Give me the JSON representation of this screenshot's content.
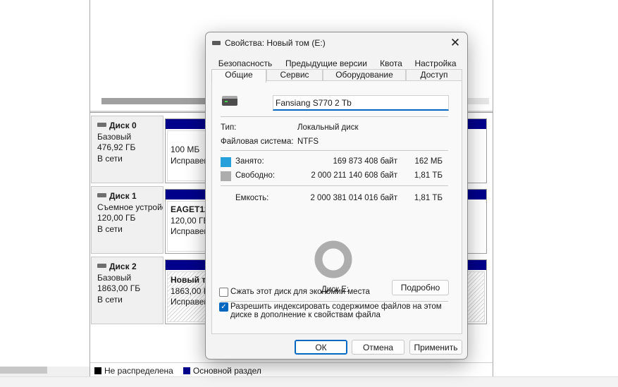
{
  "disk_management": {
    "disks": [
      {
        "name": "Диск 0",
        "type": "Базовый",
        "size": "476,92 ГБ",
        "status": "В сети",
        "partition_line1": "",
        "partition_size": "100 МБ",
        "partition_status": "Исправен"
      },
      {
        "name": "Диск 1",
        "type": "Съемное устройство",
        "size": "120,00 ГБ",
        "status": "В сети",
        "partition_line1": "EAGET128",
        "partition_size": "120,00 ГБ",
        "partition_status": "Исправен"
      },
      {
        "name": "Диск 2",
        "type": "Базовый",
        "size": "1863,00 ГБ",
        "status": "В сети",
        "partition_line1": "Новый том",
        "partition_size": "1863,00 ГБ",
        "partition_status": "Исправен"
      }
    ],
    "legend": {
      "unallocated": "Не распределена",
      "primary": "Основной раздел"
    },
    "colors": {
      "unallocated": "#000000",
      "primary": "#00008b"
    }
  },
  "dialog": {
    "title": "Свойства: Новый том (E:)",
    "tabs_row1": [
      "Безопасность",
      "Предыдущие версии",
      "Квота",
      "Настройка"
    ],
    "tabs_row2": [
      "Общие",
      "Сервис",
      "Оборудование",
      "Доступ"
    ],
    "active_tab": "Общие",
    "volume_label": "Fansiang S770 2 Tb",
    "type_label": "Тип:",
    "type_value": "Локальный диск",
    "fs_label": "Файловая система:",
    "fs_value": "NTFS",
    "used_label": "Занято:",
    "used_bytes": "169 873 408 байт",
    "used_short": "162 МБ",
    "free_label": "Свободно:",
    "free_bytes": "2 000 211 140 608 байт",
    "free_short": "1,81 ТБ",
    "capacity_label": "Емкость:",
    "capacity_bytes": "2 000 381 014 016 байт",
    "capacity_short": "1,81 ТБ",
    "used_fraction": 8.49e-05,
    "drive_caption": "Диск E:",
    "details_button": "Подробно",
    "compress_label": "Сжать этот диск для экономии места",
    "compress_checked": false,
    "index_label_line1": "Разрешить индексировать содержимое файлов на этом",
    "index_label_line2": "диске в дополнение к свойствам файла",
    "index_checked": true,
    "ok_button": "ОК",
    "cancel_button": "Отмена",
    "apply_button": "Применить",
    "colors": {
      "used": "#26a0da",
      "free": "#adadad",
      "accent": "#0067c0"
    }
  }
}
